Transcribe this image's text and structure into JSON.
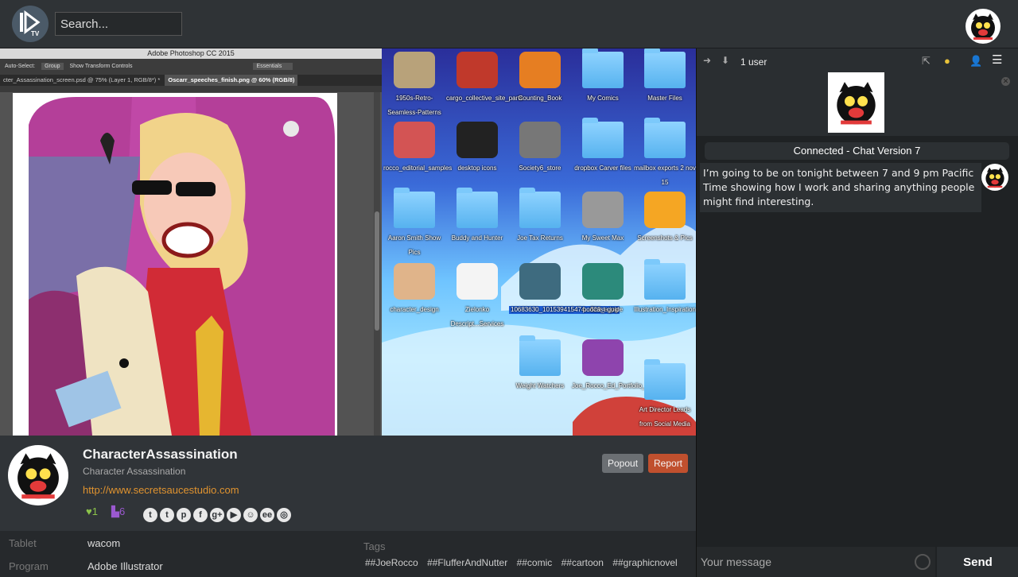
{
  "header": {
    "logo_text": "TV",
    "search_placeholder": "Search..."
  },
  "photoshop": {
    "title": "Adobe Photoshop CC 2015",
    "options": [
      "Auto-Select:",
      "Group",
      "Show Transform Controls",
      "Essentials"
    ],
    "tabs": [
      "cter_Assassination_screen.psd @ 75% (Layer 1, RGB/8*) *",
      "Oscarr_speeches_finish.png @ 60% (RGB/8)"
    ]
  },
  "desktop": {
    "icons": [
      {
        "label": "1950s-Retro-Seamless-Patterns",
        "kind": "image",
        "color": "#b8a27a"
      },
      {
        "label": "cargo_collective_site_parts",
        "kind": "image",
        "color": "#c0392b"
      },
      {
        "label": "Counting_Book",
        "kind": "image",
        "color": "#e67e22"
      },
      {
        "label": "My Comics",
        "kind": "folder"
      },
      {
        "label": "Master Files",
        "kind": "folder"
      },
      {
        "label": "rocco_editorial_samples",
        "kind": "image",
        "color": "#d35454"
      },
      {
        "label": "desktop icons",
        "kind": "image",
        "color": "#222"
      },
      {
        "label": "Society6_store",
        "kind": "image",
        "color": "#777"
      },
      {
        "label": "dropbox Carver files",
        "kind": "folder"
      },
      {
        "label": "mailbox exports 2 nov 15",
        "kind": "folder"
      },
      {
        "label": "Aaron Smith Show Pics",
        "kind": "folder"
      },
      {
        "label": "Buddy and Hunter",
        "kind": "folder"
      },
      {
        "label": "Joe Tax Returns",
        "kind": "folder"
      },
      {
        "label": "My Sweet Max",
        "kind": "image",
        "color": "#999"
      },
      {
        "label": "Screenshots & Pics",
        "kind": "image",
        "color": "#f5a623"
      },
      {
        "label": "character_design",
        "kind": "image",
        "color": "#e0b48a"
      },
      {
        "label": "Zielonko Descript...Services",
        "kind": "image",
        "color": "#f4f4f4"
      },
      {
        "label": "10683630_101539415474...523_o.jpg",
        "kind": "image",
        "color": "#3e6b7f",
        "selected": true
      },
      {
        "label": "podcast-guide",
        "kind": "image",
        "color": "#2c8a7b"
      },
      {
        "label": "Illustration_Inspiration",
        "kind": "folder"
      },
      {
        "label": "Weight Watchers",
        "kind": "folder"
      },
      {
        "label": "Joe_Rocco_Ed_Portfolio_2016.pdf",
        "kind": "image",
        "color": "#8e44ad"
      },
      {
        "label": "Art Director Leads from Social Media",
        "kind": "folder"
      }
    ]
  },
  "channel": {
    "name": "CharacterAssassination",
    "subtitle": "Character Assassination",
    "url": "http://www.secretsaucestudio.com",
    "likes": "1",
    "viewers": "6",
    "popout_label": "Popout",
    "report_label": "Report",
    "socials": [
      "t",
      "t",
      "p",
      "f",
      "g+",
      "▶",
      "☺",
      "ee",
      "◎"
    ],
    "details": [
      {
        "label": "Tablet",
        "value": "wacom"
      },
      {
        "label": "Program",
        "value": "Adobe Illustrator"
      }
    ],
    "tags_label": "Tags",
    "tags": [
      "##JoeRocco",
      "##FlufferAndNutter",
      "##comic",
      "##cartoon",
      "##graphicnovel"
    ]
  },
  "chat": {
    "user_count": "1 user",
    "status": "Connected - Chat Version 7",
    "message": "I’m going to be on tonight between 7 and 9 pm Pacific Time showing how I work and sharing anything people might find interesting.",
    "input_placeholder": "Your message",
    "send_label": "Send"
  }
}
